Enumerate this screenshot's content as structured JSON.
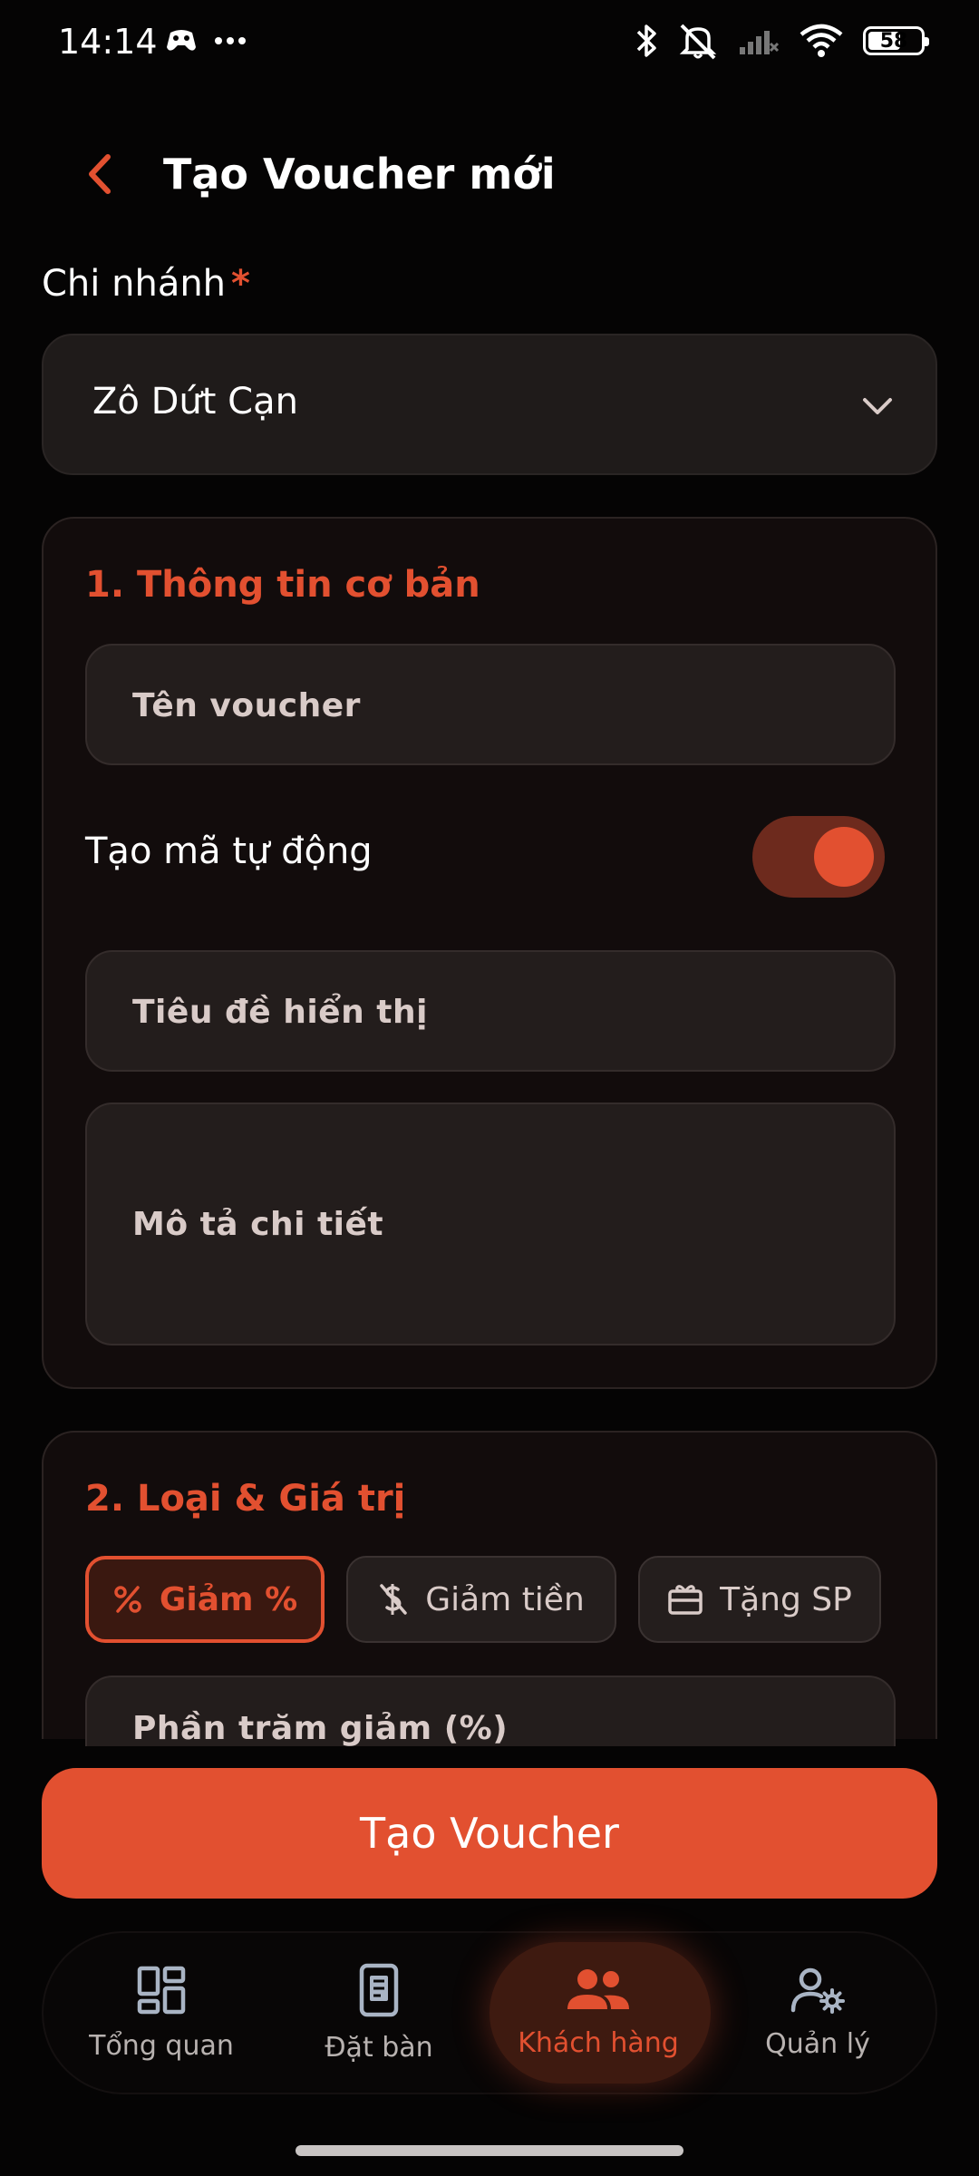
{
  "status_bar": {
    "time": "14:14",
    "battery": "58",
    "icons": [
      "game-controller-icon",
      "more-dots-icon",
      "bluetooth-icon",
      "mute-icon",
      "signal-icon",
      "wifi-icon",
      "battery-icon"
    ]
  },
  "header": {
    "title": "Tạo Voucher mới",
    "back_icon": "chevron-left-icon"
  },
  "branch": {
    "label": "Chi nhánh",
    "required_mark": "*",
    "selected_value": "Zô Dứt Cạn"
  },
  "section_basic": {
    "title": "1. Thông tin cơ bản",
    "voucher_name_label": "Tên voucher",
    "auto_code_label": "Tạo mã tự động",
    "auto_code_enabled": true,
    "display_title_label": "Tiêu đề hiển thị",
    "description_label": "Mô tả chi tiết"
  },
  "section_type": {
    "title": "2. Loại & Giá trị",
    "types": [
      {
        "label": "Giảm %",
        "icon": "percent-icon",
        "selected": true
      },
      {
        "label": "Giảm tiền",
        "icon": "money-off-icon",
        "selected": false
      },
      {
        "label": "Tặng SP",
        "icon": "gift-card-icon",
        "selected": false
      }
    ],
    "percent_label": "Phần trăm giảm (%)"
  },
  "submit_label": "Tạo Voucher",
  "bottom_nav": {
    "items": [
      {
        "label": "Tổng quan",
        "icon": "dashboard-icon",
        "active": false
      },
      {
        "label": "Đặt bàn",
        "icon": "table-booking-icon",
        "active": false
      },
      {
        "label": "Khách hàng",
        "icon": "customers-icon",
        "active": true
      },
      {
        "label": "Quản lý",
        "icon": "manage-user-icon",
        "active": false
      }
    ]
  },
  "colors": {
    "accent": "#e25030",
    "background": "#050404",
    "card": "#120c0c",
    "input": "#231d1c"
  }
}
